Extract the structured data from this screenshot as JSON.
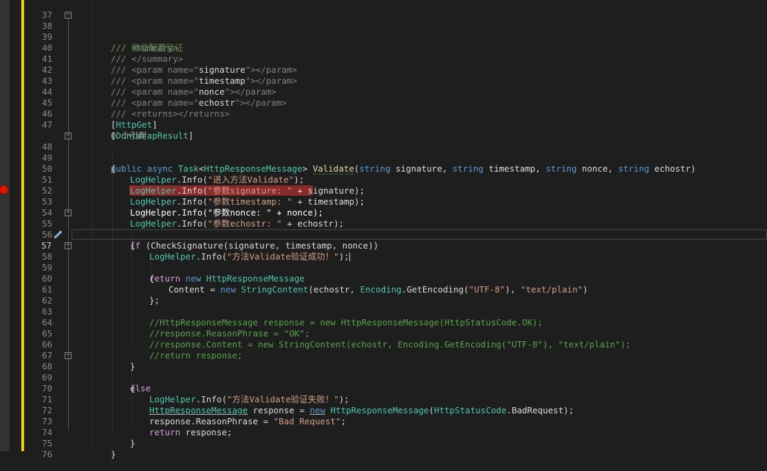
{
  "editor": {
    "line_numbers": [
      "37",
      "38",
      "39",
      "40",
      "41",
      "42",
      "43",
      "44",
      "45",
      "46",
      "47",
      "48",
      "49",
      "50",
      "51",
      "52",
      "53",
      "54",
      "55",
      "56",
      "57",
      "58",
      "59",
      "60",
      "61",
      "62",
      "63",
      "64",
      "65",
      "66",
      "67",
      "68",
      "69",
      "70",
      "71",
      "72",
      "73",
      "74",
      "75",
      "76"
    ],
    "codelens": "0 个引用",
    "current_line": "57",
    "breakpoint_line": "53"
  },
  "colors": {
    "background": "#1e1e1e",
    "change_bar": "#f2d600",
    "breakpoint": "#e51400",
    "breakpoint_highlight": "#8a2a2a",
    "comment": "#57a64a",
    "keyword": "#569cd6",
    "type": "#4ec9b0",
    "string": "#d69d85",
    "method": "#dcdcaa"
  },
  "code": {
    "l38": "/// <summary>",
    "l39": "/// 微信配置验证",
    "l40": "/// </summary>",
    "l41a": "/// <param name=\"",
    "l41b": "signature",
    "l41c": "\"></param>",
    "l42a": "/// <param name=\"",
    "l42b": "timestamp",
    "l42c": "\"></param>",
    "l43a": "/// <param name=\"",
    "l43b": "nonce",
    "l43c": "\"></param>",
    "l44a": "/// <param name=\"",
    "l44b": "echostr",
    "l44c": "\"></param>",
    "l45": "/// <returns></returns>",
    "l46a": "[",
    "l46b": "HttpGet",
    "l46c": "]",
    "l47a": "[",
    "l47b": "DontWrapResult",
    "l47c": "]",
    "l48_public": "public",
    "l48_async": "async",
    "l48_task": "Task",
    "l48_lt": "<",
    "l48_resp": "HttpResponseMessage",
    "l48_gt": ">",
    "l48_name": "Validate",
    "l48_open": "(",
    "l48_string1": "string",
    "l48_p1": " signature, ",
    "l48_string2": "string",
    "l48_p2": " timestamp, ",
    "l48_string3": "string",
    "l48_p3": " nonce, ",
    "l48_string4": "string",
    "l48_p4": " echostr)",
    "l49": "{",
    "l50a": "LogHelper",
    "l50b": ".Info(",
    "l50c": "\"进入方法Validate\"",
    "l50d": ");",
    "l51a": "LogHelper",
    "l51b": ".Info(",
    "l51c": "\"参数signature: \"",
    "l51d": " + signature);",
    "l52a": "LogHelper",
    "l52b": ".Info(",
    "l52c": "\"参数timestamp: \"",
    "l52d": " + timestamp);",
    "l53": "LogHelper.Info(\"参数nonce: \" + nonce);",
    "l54a": "LogHelper",
    "l54b": ".Info(",
    "l54c": "\"参数echostr: \"",
    "l54d": " + echostr);",
    "l55a": "if",
    "l55b": " (CheckSignature(signature, timestamp, nonce))",
    "l56": "{",
    "l57a": "LogHelper",
    "l57b": ".Info(",
    "l57c": "\"方法Validate验证成功！\"",
    "l57d": ");",
    "l58a": "return",
    "l58b": "new",
    "l58c": "HttpResponseMessage",
    "l59": "{",
    "l60a": "Content = ",
    "l60b": "new",
    "l60c": "StringContent",
    "l60d": "(echostr, ",
    "l60e": "Encoding",
    "l60f": ".GetEncoding(",
    "l60g": "\"UTF-8\"",
    "l60h": "), ",
    "l60i": "\"text/plain\"",
    "l60j": ")",
    "l61": "};",
    "l63": "//HttpResponseMessage response = new HttpResponseMessage(HttpStatusCode.OK);",
    "l64": "//response.ReasonPhrase = \"OK\";",
    "l65": "//response.Content = new StringContent(echostr, Encoding.GetEncoding(\"UTF-8\"), \"text/plain\");",
    "l66": "//return response;",
    "l67": "}",
    "l68": "else",
    "l69": "{",
    "l70a": "LogHelper",
    "l70b": ".Info(",
    "l70c": "\"方法Validate验证失败！\"",
    "l70d": ");",
    "l71a": "HttpResponseMessage",
    "l71b": " response = ",
    "l71c": "new",
    "l71d": "HttpResponseMessage",
    "l71e": "(",
    "l71f": "HttpStatusCode",
    "l71g": ".BadRequest);",
    "l72a": "response.ReasonPhrase = ",
    "l72b": "\"Bad Request\"",
    "l72c": ";",
    "l73a": "return",
    "l73b": " response;",
    "l74": "}",
    "l75": "}"
  }
}
